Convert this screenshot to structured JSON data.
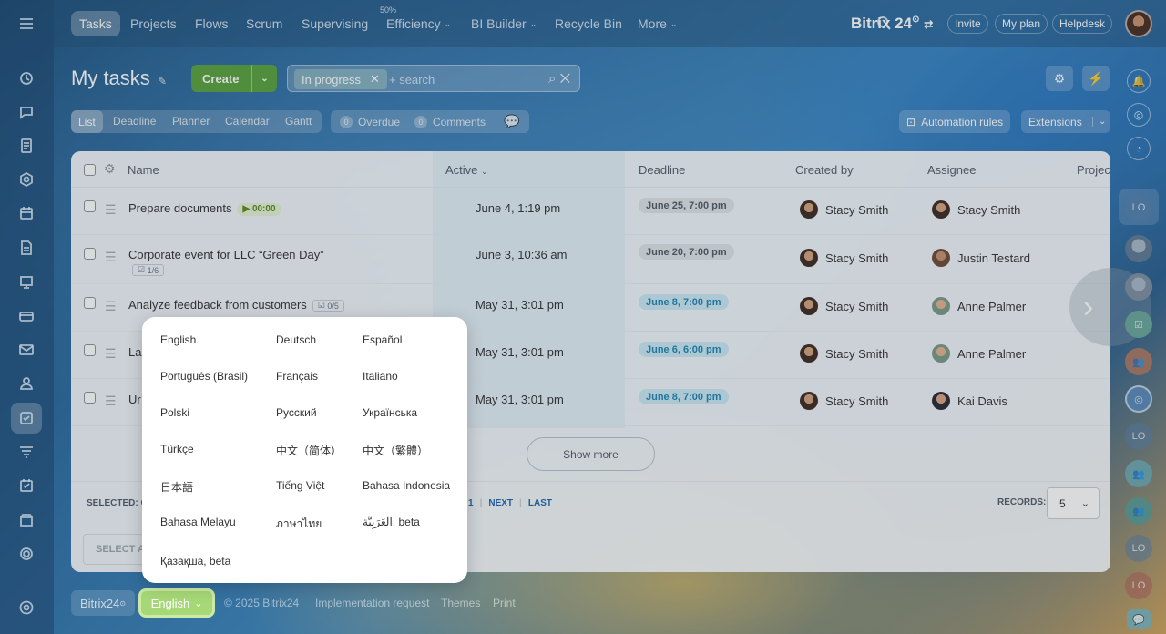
{
  "topbar": {
    "tabs": [
      {
        "label": "Tasks",
        "active": true
      },
      {
        "label": "Projects"
      },
      {
        "label": "Flows"
      },
      {
        "label": "Scrum"
      },
      {
        "label": "Supervising"
      },
      {
        "label": "Efficiency",
        "superscript": "50%",
        "dropdown": true
      },
      {
        "label": "BI Builder",
        "dropdown": true
      },
      {
        "label": "Recycle Bin"
      },
      {
        "label": "More",
        "dropdown": true
      }
    ],
    "brand": "Bitrix 24",
    "invite_label": "Invite",
    "myplan_label": "My plan",
    "helpdesk_label": "Helpdesk"
  },
  "header": {
    "title": "My tasks",
    "create_label": "Create",
    "filter_chip": "In progress",
    "search_placeholder": "+ search"
  },
  "views": {
    "items": [
      "List",
      "Deadline",
      "Planner",
      "Calendar",
      "Gantt"
    ],
    "active": "List",
    "overdue_count": "0",
    "overdue_label": "Overdue",
    "comments_count": "0",
    "comments_label": "Comments",
    "automation_label": "Automation rules",
    "extensions_label": "Extensions"
  },
  "table": {
    "columns": [
      "Name",
      "Active",
      "Deadline",
      "Created by",
      "Assignee",
      "Projec"
    ],
    "rows": [
      {
        "name": "Prepare documents",
        "timer": "00:00",
        "active": "June 4, 1:19 pm",
        "deadline": "June 25, 7:00 pm",
        "deadline_style": "grey",
        "created_by": "Stacy Smith",
        "assignee": "Stacy Smith"
      },
      {
        "name": "Corporate event for LLC “Green Day”",
        "checklist": "1/6",
        "active": "June 3, 10:36 am",
        "deadline": "June 20, 7:00 pm",
        "deadline_style": "grey",
        "created_by": "Stacy Smith",
        "assignee": "Justin Testard"
      },
      {
        "name": "Analyze feedback from customers",
        "checklist": "0/5",
        "active": "May 31, 3:01 pm",
        "deadline": "June 8, 7:00 pm",
        "deadline_style": "blue",
        "created_by": "Stacy Smith",
        "assignee": "Anne Palmer"
      },
      {
        "name": "La",
        "active": "May 31, 3:01 pm",
        "deadline": "June 6, 6:00 pm",
        "deadline_style": "blue",
        "created_by": "Stacy Smith",
        "assignee": "Anne Palmer"
      },
      {
        "name": "Ur",
        "active": "May 31, 3:01 pm",
        "deadline": "June 8, 7:00 pm",
        "deadline_style": "blue",
        "created_by": "Stacy Smith",
        "assignee": "Kai Davis"
      }
    ],
    "show_more_label": "Show more",
    "selected_label": "SELECTED: C",
    "pager": [
      "1",
      "NEXT",
      "LAST"
    ],
    "records_label": "RECORDS:",
    "records_value": "5",
    "select_action_placeholder": "SELECT A"
  },
  "right_rail": {
    "lo_label": "LO"
  },
  "languages": [
    "English",
    "Deutsch",
    "Español",
    "Português (Brasil)",
    "Français",
    "Italiano",
    "Polski",
    "Русский",
    "Українська",
    "Türkçe",
    "中文（简体）",
    "中文（繁體）",
    "日本語",
    "Tiếng Việt",
    "Bahasa Indonesia",
    "Bahasa Melayu",
    "ภาษาไทย",
    "العَرَبِيَّة, beta",
    "Қазақша, beta"
  ],
  "footer": {
    "brand": "Bitrix24",
    "language": "English",
    "copyright": "© 2025 Bitrix24",
    "implementation": "Implementation request",
    "themes": "Themes",
    "print": "Print"
  }
}
